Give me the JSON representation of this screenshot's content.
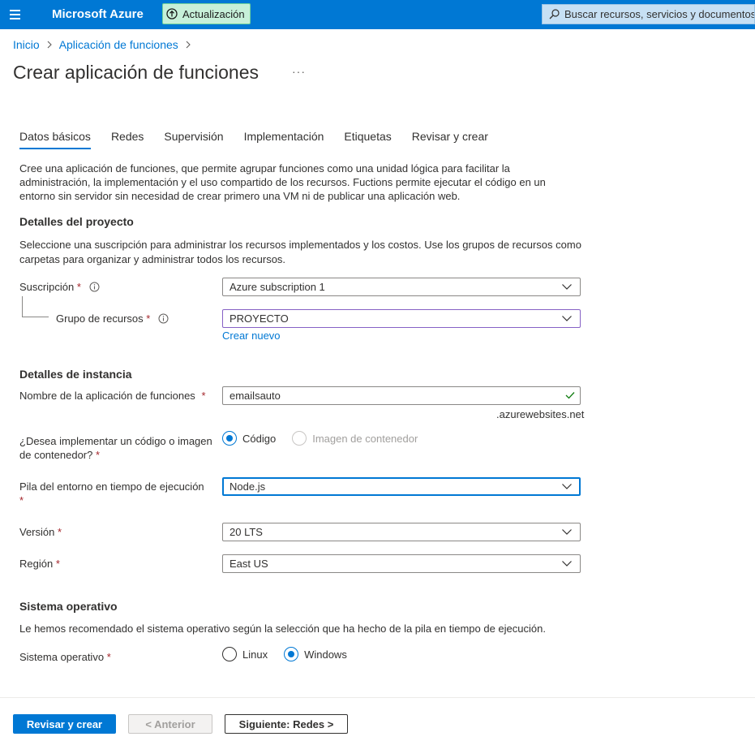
{
  "topbar": {
    "brand": "Microsoft Azure",
    "update_label": "Actualización",
    "search_placeholder": "Buscar recursos, servicios y documentos"
  },
  "breadcrumb": {
    "items": [
      "Inicio",
      "Aplicación de funciones"
    ]
  },
  "page": {
    "title": "Crear aplicación de funciones",
    "more": "···"
  },
  "tabs": [
    "Datos básicos",
    "Redes",
    "Supervisión",
    "Implementación",
    "Etiquetas",
    "Revisar y crear"
  ],
  "intro": "Cree una aplicación de funciones, que permite agrupar funciones como una unidad lógica para facilitar la administración, la implementación y el uso compartido de los recursos. Fuctions permite ejecutar el código en un entorno sin servidor sin necesidad de crear primero una VM ni de publicar una aplicación web.",
  "project": {
    "title": "Detalles del proyecto",
    "description": "Seleccione una suscripción para administrar los recursos implementados y los costos. Use los grupos de recursos como carpetas para organizar y administrar todos los recursos.",
    "subscription_label": "Suscripción",
    "subscription_value": "Azure subscription 1",
    "resource_group_label": "Grupo de recursos",
    "resource_group_value": "PROYECTO",
    "create_new": "Crear nuevo",
    "required_mark": "*"
  },
  "instance": {
    "title": "Detalles de instancia",
    "name_label": "Nombre de la aplicación de funciones",
    "name_value": "emailsauto",
    "name_suffix": ".azurewebsites.net",
    "deploy_label_1": "¿Desea implementar un código o imagen",
    "deploy_label_2": "de contenedor?",
    "deploy_options": [
      "Código",
      "Imagen de contenedor"
    ],
    "deploy_selected": "Código",
    "runtime_label": "Pila del entorno en tiempo de ejecución",
    "runtime_value": "Node.js",
    "version_label": "Versión",
    "version_value": "20 LTS",
    "region_label": "Región",
    "region_value": "East US"
  },
  "os": {
    "title": "Sistema operativo",
    "description": "Le hemos recomendado el sistema operativo según la selección que ha hecho de la pila en tiempo de ejecución.",
    "label": "Sistema operativo",
    "options": [
      "Linux",
      "Windows"
    ],
    "selected": "Windows"
  },
  "footer": {
    "review_create": "Revisar y crear",
    "previous": "< Anterior",
    "next": "Siguiente: Redes >"
  },
  "colors": {
    "accent": "#0078d4",
    "required": "#a4262c",
    "success": "#107c10"
  }
}
